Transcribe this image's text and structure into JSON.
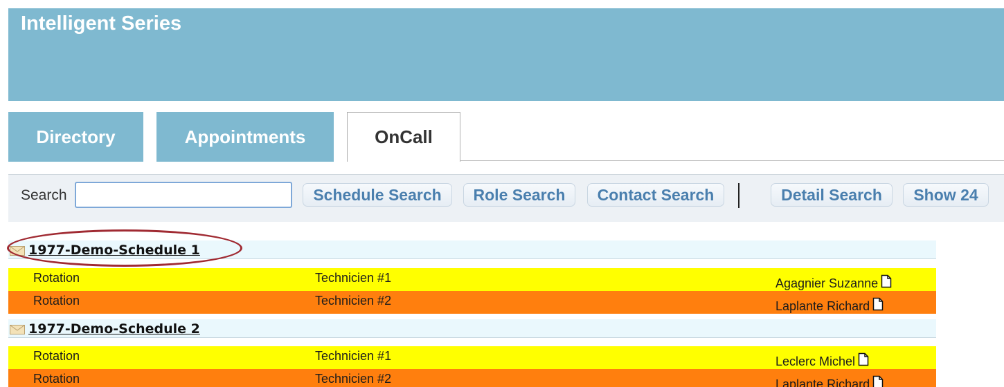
{
  "app": {
    "title": "Intelligent Series"
  },
  "tabs": [
    {
      "label": "Directory",
      "active": false
    },
    {
      "label": "Appointments",
      "active": false
    },
    {
      "label": "OnCall",
      "active": true
    }
  ],
  "toolbar": {
    "search_label": "Search",
    "search_value": "",
    "buttons": [
      "Schedule Search",
      "Role Search",
      "Contact Search",
      "Detail Search",
      "Show 24"
    ]
  },
  "schedules": [
    {
      "name": "1977-Demo-Schedule 1",
      "rows": [
        {
          "role": "Rotation",
          "tech": "Technicien #1",
          "contact": "Agagnier Suzanne",
          "color": "yellow"
        },
        {
          "role": "Rotation",
          "tech": "Technicien #2",
          "contact": "Laplante Richard",
          "color": "orange"
        }
      ]
    },
    {
      "name": "1977-Demo-Schedule 2",
      "rows": [
        {
          "role": "Rotation",
          "tech": "Technicien #1",
          "contact": "Leclerc Michel",
          "color": "yellow"
        },
        {
          "role": "Rotation",
          "tech": "Technicien #2",
          "contact": "Laplante Richard",
          "color": "orange"
        }
      ]
    }
  ],
  "colors": {
    "header_bg": "#7fb9d0",
    "row_yellow": "#ffff00",
    "row_orange": "#ff7f0e",
    "button_text": "#4a7fae",
    "annotation": "#a02a32"
  },
  "icons": [
    "envelope-icon",
    "document-icon"
  ]
}
